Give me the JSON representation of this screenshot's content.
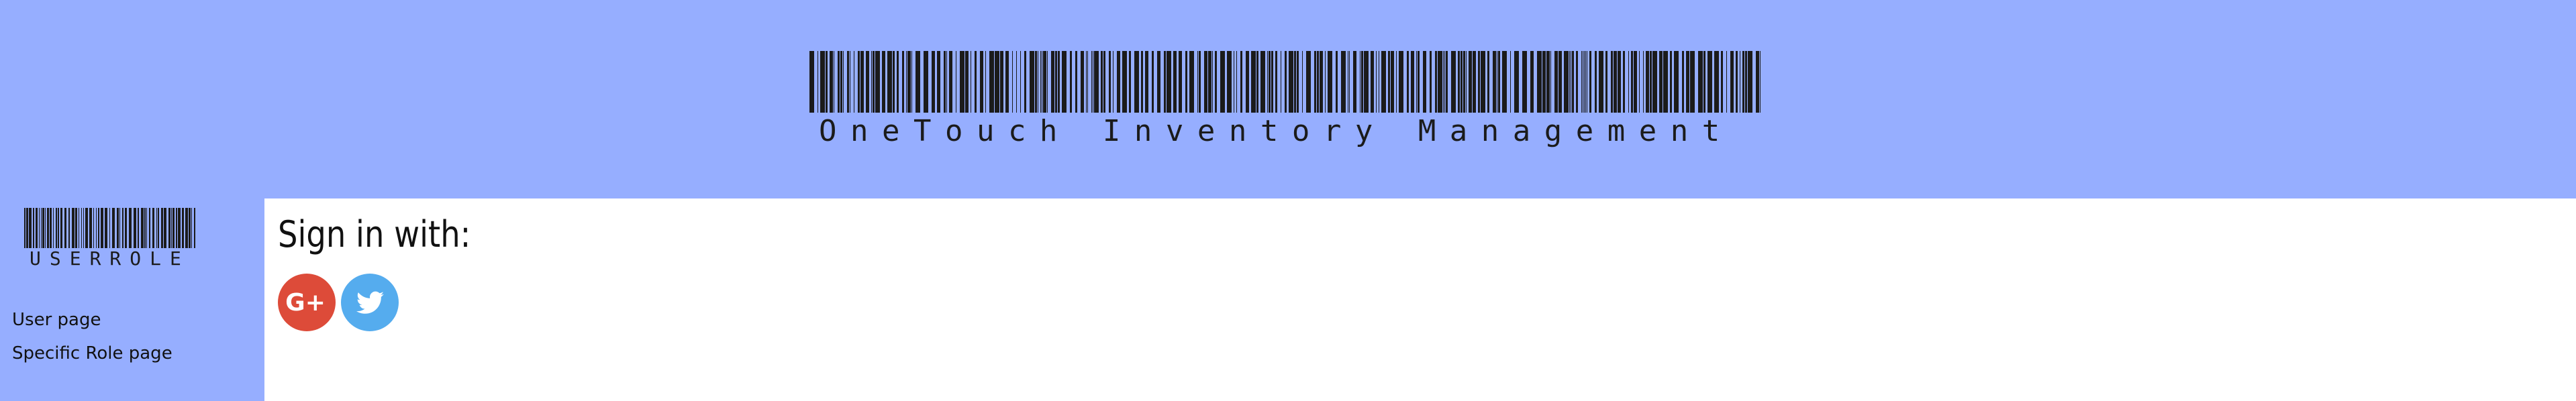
{
  "header": {
    "logo_text": "OneTouch Inventory Management"
  },
  "sidebar": {
    "logo_text": "USERROLE",
    "items": [
      {
        "label": "User page"
      },
      {
        "label": "Specific Role page"
      }
    ]
  },
  "main": {
    "signin_title": "Sign in with:",
    "social": [
      {
        "icon": "google-plus-icon",
        "label": "G+",
        "color": "#dd4b39"
      },
      {
        "icon": "twitter-icon",
        "color": "#55acee"
      }
    ]
  },
  "colors": {
    "header_bg": "#96aeff",
    "sidebar_bg": "#96aeff",
    "main_bg": "#ffffff",
    "barcode": "#1b1b1b"
  }
}
